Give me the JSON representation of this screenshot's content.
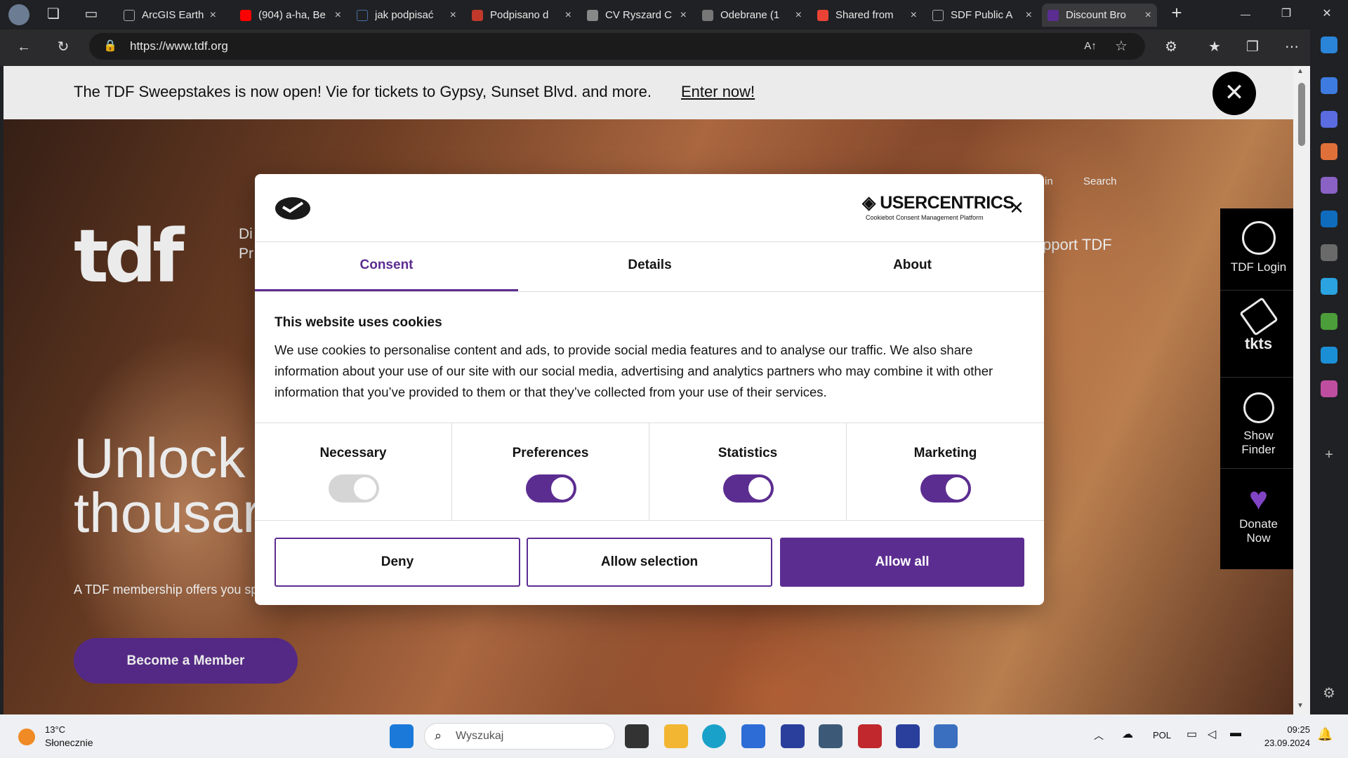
{
  "browser": {
    "tabs": [
      {
        "label": "ArcGIS Earth",
        "color": "#555555"
      },
      {
        "label": "(904) a-ha, Be",
        "color": "#ff0000"
      },
      {
        "label": "jak podpisać",
        "color": "#3a3a3d"
      },
      {
        "label": "Podpisano d",
        "color": "#c0392b"
      },
      {
        "label": "CV Ryszard C",
        "color": "#888888"
      },
      {
        "label": "Odebrane (1",
        "color": "#3a3a3d"
      },
      {
        "label": "Shared from",
        "color": "#ea4335"
      },
      {
        "label": "SDF Public A",
        "color": "#555555"
      },
      {
        "label": "Discount Bro",
        "color": "#5c2d91"
      }
    ],
    "tab_close": "×",
    "new_tab": "+",
    "url": "https://www.tdf.org",
    "window_controls": {
      "minimize": "—",
      "maximize": "❐",
      "close": "✕"
    }
  },
  "banner": {
    "text": "The TDF Sweepstakes is now open! Vie for tickets to Gypsy, Sunset Blvd. and more.",
    "link": "Enter now!",
    "close": "✕"
  },
  "site": {
    "logo": "tdf",
    "nav_left_1": "Di",
    "nav_left_2": "Pr",
    "nav_right_partial": "in",
    "search": "Search",
    "support": "pport TDF",
    "hero_title_1": "Unlock",
    "hero_title_2": "thousar",
    "hero_sub": "A TDF membership offers you spe",
    "member_button": "Become a Member"
  },
  "sidenav": {
    "login": "TDF Login",
    "tkts": "tkts",
    "show_finder_1": "Show",
    "show_finder_2": "Finder",
    "donate_1": "Donate",
    "donate_2": "Now"
  },
  "consent": {
    "brand": "USERCENTRICS",
    "brand_sub": "Cookiebot Consent Management Platform",
    "close": "✕",
    "tabs": [
      "Consent",
      "Details",
      "About"
    ],
    "heading": "This website uses cookies",
    "body": "We use cookies to personalise content and ads, to provide social media features and to analyse our traffic. We also share information about your use of our site with our social media, advertising and analytics partners who may combine it with other information that you’ve provided to them or that they’ve collected from your use of their services.",
    "categories": [
      {
        "label": "Necessary",
        "enabled": true,
        "locked": true
      },
      {
        "label": "Preferences",
        "enabled": true,
        "locked": false
      },
      {
        "label": "Statistics",
        "enabled": true,
        "locked": false
      },
      {
        "label": "Marketing",
        "enabled": true,
        "locked": false
      }
    ],
    "deny": "Deny",
    "allow_selection": "Allow selection",
    "allow_all": "Allow all",
    "accent": "#5c2d91"
  },
  "taskbar": {
    "weather_temp": "13°C",
    "weather_desc": "Słonecznie",
    "search_placeholder": "Wyszukaj",
    "lang": "POL",
    "time": "09:25",
    "date": "23.09.2024"
  }
}
